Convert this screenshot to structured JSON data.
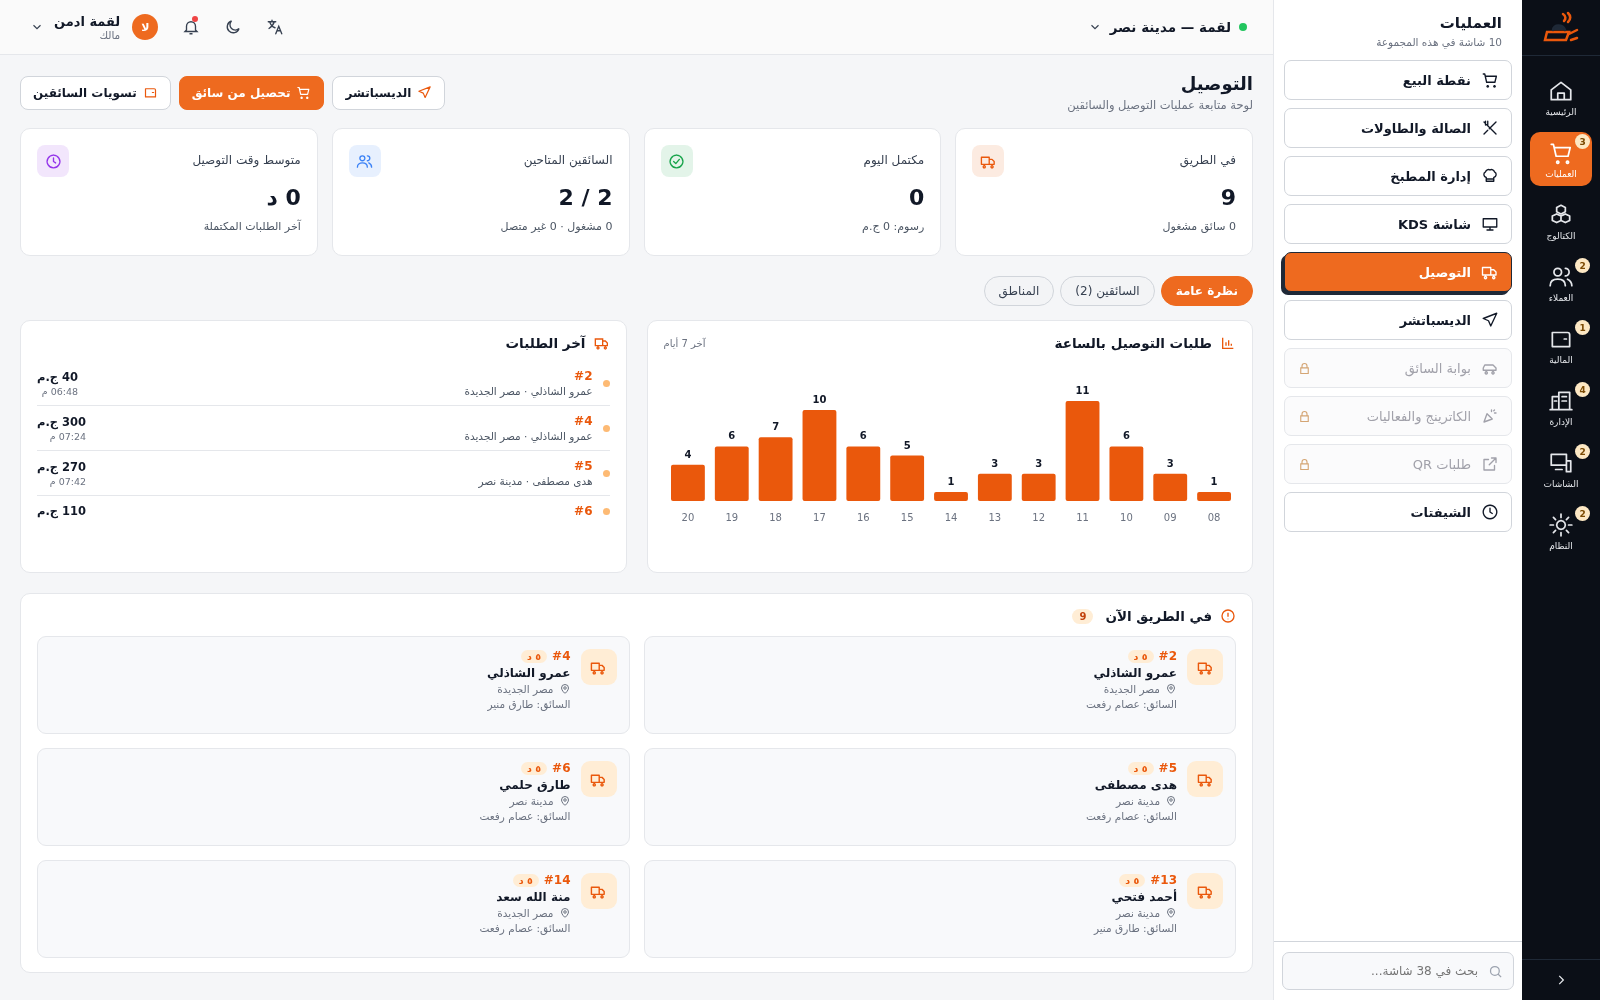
{
  "rail": {
    "items": [
      {
        "label": "الرئيسية",
        "selected": false
      },
      {
        "label": "العمليات",
        "badge": "3",
        "selected": true
      },
      {
        "label": "الكتالوج",
        "selected": false
      },
      {
        "label": "العملاء",
        "badge": "2",
        "selected": false
      },
      {
        "label": "المالية",
        "badge": "1",
        "selected": false
      },
      {
        "label": "الإدارة",
        "badge": "4",
        "selected": false
      },
      {
        "label": "الشاشات",
        "badge": "2",
        "selected": false
      },
      {
        "label": "النظام",
        "badge": "2",
        "selected": false
      }
    ]
  },
  "panel": {
    "title": "العمليات",
    "subtitle": "10 شاشة في هذه المجموعة",
    "items": [
      {
        "label": "نقطة البيع",
        "selected": false,
        "locked": false
      },
      {
        "label": "الصالة والطاولات",
        "selected": false,
        "locked": false
      },
      {
        "label": "إدارة المطبخ",
        "selected": false,
        "locked": false
      },
      {
        "label": "شاشة KDS",
        "selected": false,
        "locked": false
      },
      {
        "label": "التوصيل",
        "selected": true,
        "locked": false
      },
      {
        "label": "الديسباتشر",
        "selected": false,
        "locked": false
      },
      {
        "label": "بوابة السائق",
        "selected": false,
        "locked": true
      },
      {
        "label": "الكاترينج والفعاليات",
        "selected": false,
        "locked": true
      },
      {
        "label": "طلبات QR",
        "selected": false,
        "locked": true
      },
      {
        "label": "الشيفتات",
        "selected": false,
        "locked": false
      }
    ],
    "search": {
      "placeholder": "بحث في 38 شاشة..."
    }
  },
  "topbar": {
    "branch": {
      "name": "لقمة — مدينة نصر",
      "online": true
    },
    "notifications": {
      "unread": true
    },
    "user": {
      "initials": "لا",
      "name": "لقمة ادمن",
      "role": "مالك"
    }
  },
  "header": {
    "title": "التوصيل",
    "subtitle": "لوحة متابعة عمليات التوصيل والسائقين",
    "buttons": [
      {
        "label": "الديسباتشر",
        "primary": false
      },
      {
        "label": "تحصيل من سائق",
        "primary": true
      },
      {
        "label": "تسويات السائقين",
        "primary": false
      }
    ]
  },
  "stats": [
    {
      "title": "في الطريق",
      "value": "9",
      "note": "0 سائق مشغول",
      "color": "#ea580c"
    },
    {
      "title": "مكتمل اليوم",
      "value": "0",
      "note": "رسوم: 0 ج.م",
      "color": "#16a34a"
    },
    {
      "title": "السائقين المتاحين",
      "value": "2 / 2",
      "note": "0 مشغول · 0 غير متصل",
      "color": "#3b82f6"
    },
    {
      "title": "متوسط وقت التوصيل",
      "value": "0 د",
      "note": "آخر الطلبات المكتملة",
      "color": "#9333ea"
    }
  ],
  "tabs": [
    {
      "label": "نظرة عامة",
      "selected": true
    },
    {
      "label": "السائقين (2)",
      "selected": false
    },
    {
      "label": "المناطق",
      "selected": false
    }
  ],
  "hourly_chart": {
    "title": "طلبات التوصيل بالساعة",
    "period": "آخر 7 أيام",
    "chart_data": {
      "type": "bar",
      "categories": [
        "20",
        "19",
        "18",
        "17",
        "16",
        "15",
        "14",
        "13",
        "12",
        "11",
        "10",
        "09",
        "08"
      ],
      "values": [
        4,
        6,
        7,
        10,
        6,
        5,
        1,
        3,
        3,
        11,
        6,
        3,
        1
      ],
      "data_labels": true
    }
  },
  "recent_orders": {
    "title": "آخر الطلبات",
    "orders": [
      {
        "number": "#2",
        "details": "عمرو الشاذلي · مصر الجديدة",
        "amount": "40 ج.م",
        "time": "06:48 م"
      },
      {
        "number": "#4",
        "details": "عمرو الشاذلي · مصر الجديدة",
        "amount": "300 ج.م",
        "time": "07:24 م"
      },
      {
        "number": "#5",
        "details": "هدى مصطفى · مدينة نصر",
        "amount": "270 ج.م",
        "time": "07:42 م"
      },
      {
        "number": "#6",
        "amount": "110 ج.م"
      }
    ]
  },
  "on_road": {
    "title": "في الطريق الآن",
    "count": "9",
    "deliveries": [
      {
        "number": "#2",
        "elapsed": "٥ د",
        "customer": "عمرو الشاذلي",
        "area": "مصر الجديدة",
        "driver": "السائق: عصام رفعت"
      },
      {
        "number": "#4",
        "elapsed": "٥ د",
        "customer": "عمرو الشاذلي",
        "area": "مصر الجديدة",
        "driver": "السائق: طارق منير"
      },
      {
        "number": "#5",
        "elapsed": "٥ د",
        "customer": "هدى مصطفى",
        "area": "مدينة نصر",
        "driver": "السائق: عصام رفعت"
      },
      {
        "number": "#6",
        "elapsed": "٥ د",
        "customer": "طارق حلمي",
        "area": "مدينة نصر",
        "driver": "السائق: عصام رفعت"
      },
      {
        "number": "#13",
        "elapsed": "٥ د",
        "customer": "أحمد فتحي",
        "area": "مدينة نصر",
        "driver": "السائق: طارق منير"
      },
      {
        "number": "#14",
        "elapsed": "٥ د",
        "customer": "منة الله سعد",
        "area": "مصر الجديدة",
        "driver": "السائق: عصام رفعت"
      }
    ]
  }
}
